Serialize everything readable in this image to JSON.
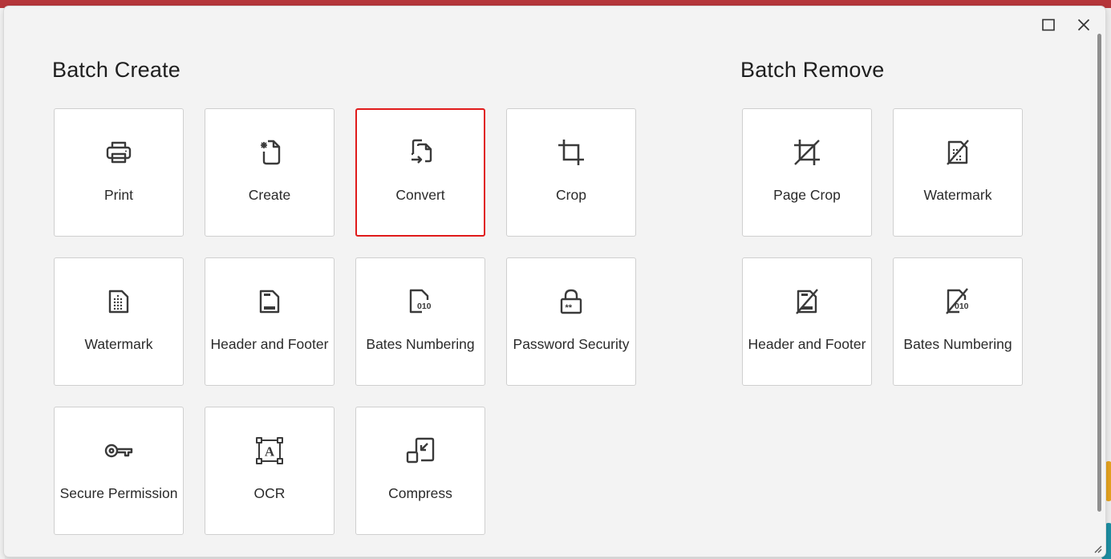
{
  "dialog": {
    "maximize_icon": "maximize-icon",
    "close_icon": "close-icon"
  },
  "batch_create": {
    "title": "Batch Create",
    "tiles": [
      {
        "label": "Print",
        "icon": "printer-icon"
      },
      {
        "label": "Create",
        "icon": "create-document-icon"
      },
      {
        "label": "Convert",
        "icon": "convert-icon",
        "selected": true
      },
      {
        "label": "Crop",
        "icon": "crop-icon"
      },
      {
        "label": "Watermark",
        "icon": "watermark-icon"
      },
      {
        "label": "Header and Footer",
        "icon": "header-footer-icon"
      },
      {
        "label": "Bates Numbering",
        "icon": "bates-numbering-icon"
      },
      {
        "label": "Password Security",
        "icon": "lock-icon"
      },
      {
        "label": "Secure Permission",
        "icon": "key-icon"
      },
      {
        "label": "OCR",
        "icon": "ocr-icon"
      },
      {
        "label": "Compress",
        "icon": "compress-icon"
      }
    ]
  },
  "batch_remove": {
    "title": "Batch Remove",
    "tiles": [
      {
        "label": "Page Crop",
        "icon": "remove-crop-icon"
      },
      {
        "label": "Watermark",
        "icon": "remove-watermark-icon"
      },
      {
        "label": "Header and Footer",
        "icon": "remove-header-footer-icon"
      },
      {
        "label": "Bates Numbering",
        "icon": "remove-bates-icon"
      }
    ]
  },
  "colors": {
    "selected_border": "#e01b1b",
    "tile_background": "#ffffff",
    "dialog_background": "#f3f3f3",
    "icon": "#3a3a3a"
  }
}
